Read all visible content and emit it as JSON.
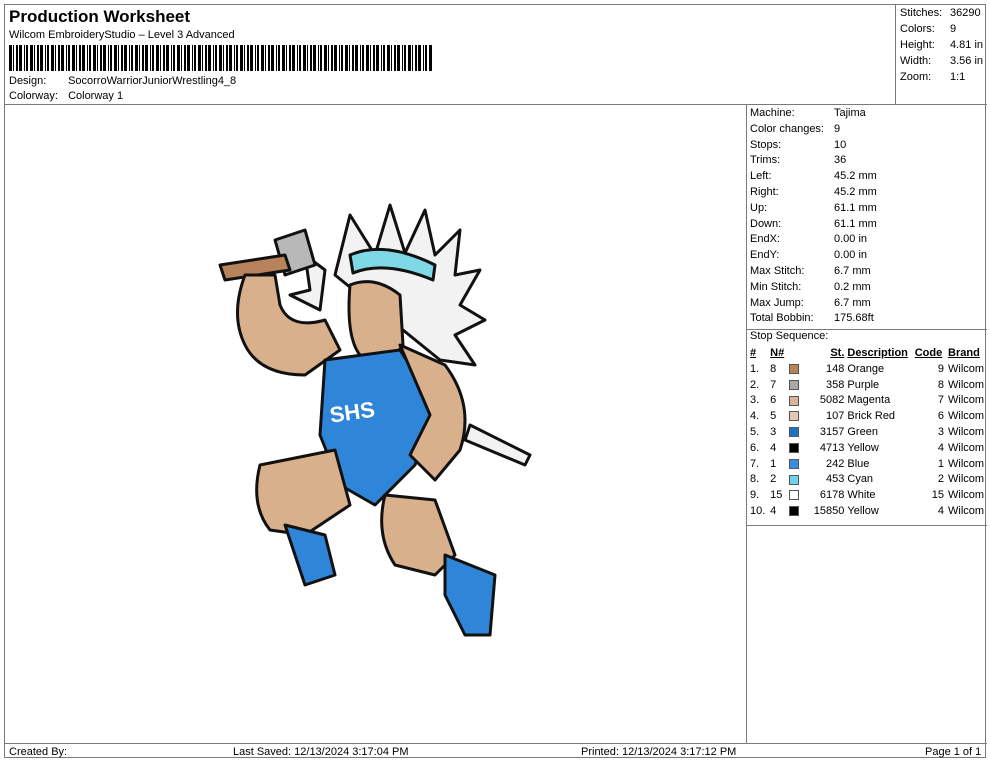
{
  "header": {
    "title": "Production Worksheet",
    "subtitle": "Wilcom EmbroideryStudio – Level 3 Advanced",
    "design_label": "Design:",
    "design_value": "SocorroWarriorJuniorWrestling4_8",
    "colorway_label": "Colorway:",
    "colorway_value": "Colorway 1"
  },
  "top_stats": [
    {
      "label": "Stitches:",
      "value": "36290"
    },
    {
      "label": "Colors:",
      "value": "9"
    },
    {
      "label": "Height:",
      "value": "4.81 in"
    },
    {
      "label": "Width:",
      "value": "3.56 in"
    },
    {
      "label": "Zoom:",
      "value": "1:1"
    }
  ],
  "machine_stats": [
    {
      "label": "Machine:",
      "value": "Tajima"
    },
    {
      "label": "Color changes:",
      "value": "9"
    },
    {
      "label": "Stops:",
      "value": "10"
    },
    {
      "label": "Trims:",
      "value": "36"
    },
    {
      "label": "Left:",
      "value": "45.2 mm"
    },
    {
      "label": "Right:",
      "value": "45.2 mm"
    },
    {
      "label": "Up:",
      "value": "61.1 mm"
    },
    {
      "label": "Down:",
      "value": "61.1 mm"
    },
    {
      "label": "EndX:",
      "value": "0.00 in"
    },
    {
      "label": "EndY:",
      "value": "0.00 in"
    },
    {
      "label": "Max Stitch:",
      "value": "6.7 mm"
    },
    {
      "label": "Min Stitch:",
      "value": "0.2 mm"
    },
    {
      "label": "Max Jump:",
      "value": "6.7 mm"
    },
    {
      "label": "Total Bobbin:",
      "value": "175.68ft"
    }
  ],
  "stop_sequence": {
    "title": "Stop Sequence:",
    "headers": {
      "idx": "#",
      "n": "N#",
      "st": "St.",
      "desc": "Description",
      "code": "Code",
      "brand": "Brand"
    },
    "rows": [
      {
        "idx": "1.",
        "n": "8",
        "color": "#b8825a",
        "st": "148",
        "desc": "Orange",
        "code": "9",
        "brand": "Wilcom"
      },
      {
        "idx": "2.",
        "n": "7",
        "color": "#a8a8a8",
        "st": "358",
        "desc": "Purple",
        "code": "8",
        "brand": "Wilcom"
      },
      {
        "idx": "3.",
        "n": "6",
        "color": "#d9b49a",
        "st": "5082",
        "desc": "Magenta",
        "code": "7",
        "brand": "Wilcom"
      },
      {
        "idx": "4.",
        "n": "5",
        "color": "#e8c8b4",
        "st": "107",
        "desc": "Brick Red",
        "code": "6",
        "brand": "Wilcom"
      },
      {
        "idx": "5.",
        "n": "3",
        "color": "#1f6fc8",
        "st": "3157",
        "desc": "Green",
        "code": "3",
        "brand": "Wilcom"
      },
      {
        "idx": "6.",
        "n": "4",
        "color": "#000000",
        "st": "4713",
        "desc": "Yellow",
        "code": "4",
        "brand": "Wilcom"
      },
      {
        "idx": "7.",
        "n": "1",
        "color": "#3a8ae8",
        "st": "242",
        "desc": "Blue",
        "code": "1",
        "brand": "Wilcom"
      },
      {
        "idx": "8.",
        "n": "2",
        "color": "#6fd4e8",
        "st": "453",
        "desc": "Cyan",
        "code": "2",
        "brand": "Wilcom"
      },
      {
        "idx": "9.",
        "n": "15",
        "color": "#ffffff",
        "st": "6178",
        "desc": "White",
        "code": "15",
        "brand": "Wilcom"
      },
      {
        "idx": "10.",
        "n": "4",
        "color": "#000000",
        "st": "15850",
        "desc": "Yellow",
        "code": "4",
        "brand": "Wilcom"
      }
    ]
  },
  "design_art": {
    "jersey_text": "SHS",
    "colors": {
      "blue": "#2f86d9",
      "skin": "#d9b08c",
      "outline": "#111111",
      "feather_white": "#f2f2f2",
      "feather_cyan": "#7fd8e6"
    }
  },
  "footer": {
    "created_by": "Created By:",
    "last_saved": "Last Saved: 12/13/2024 3:17:04 PM",
    "printed": "Printed: 12/13/2024 3:17:12 PM",
    "page": "Page 1 of 1"
  }
}
